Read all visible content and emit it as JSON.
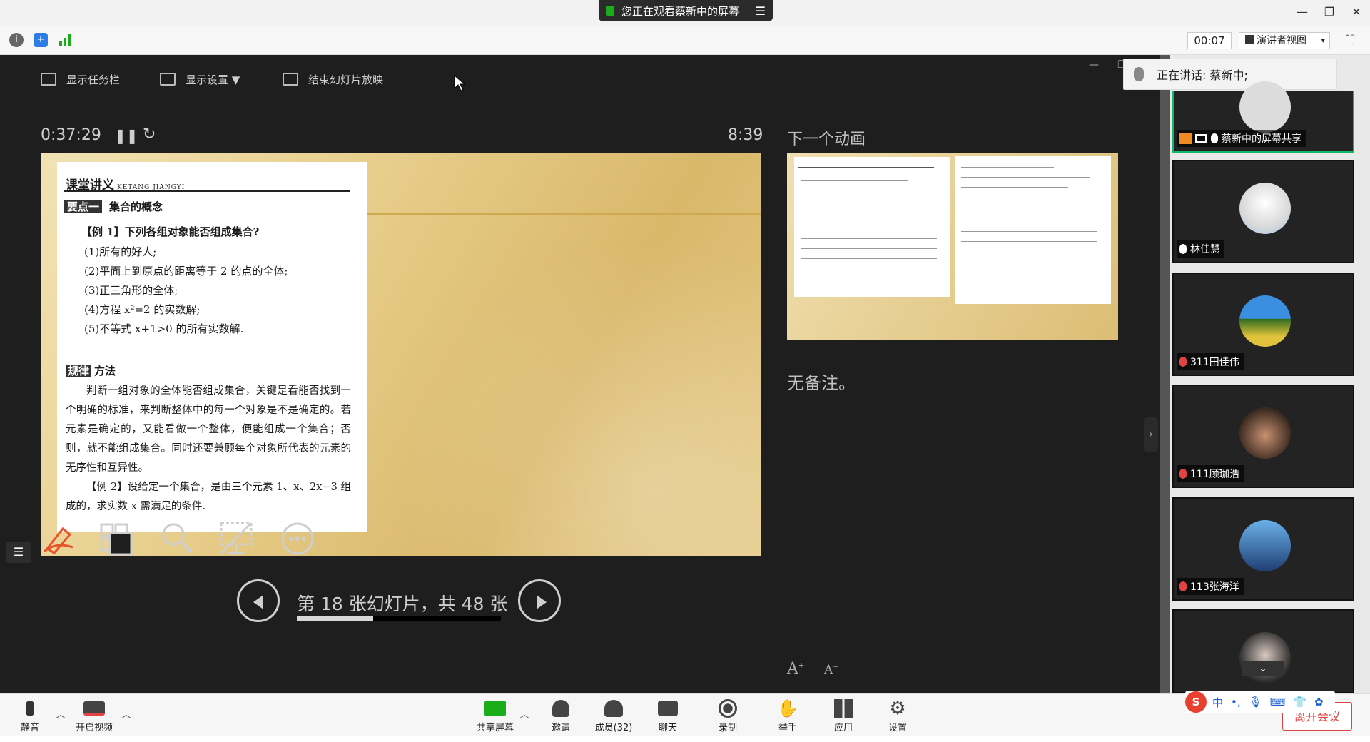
{
  "titlebar": {
    "sharing_text": "您正在观看蔡新中的屏幕",
    "menu_icon": "hamburger-icon",
    "window_controls": [
      "minimize-icon",
      "restore-icon",
      "close-icon"
    ]
  },
  "infobar": {
    "icons": [
      "info-icon",
      "shield-icon",
      "signal-icon"
    ],
    "timer": "00:07",
    "view_mode": "演讲者视图",
    "view_caret": "▾"
  },
  "presenter": {
    "toolbar": {
      "show_taskbar": "显示任务栏",
      "display_settings": "显示设置 ▼",
      "end_slideshow": "结束幻灯片放映"
    },
    "elapsed": "0:37:29",
    "clock": "8:39",
    "next_label": "下一个动画",
    "notes": "无备注。",
    "slide_counter": "第 18 张幻灯片，共 48 张",
    "progress": 0.375,
    "font_up": "A",
    "font_down": "A",
    "slide": {
      "header": "课堂讲义",
      "header_sub": "KETANG JIANGYI",
      "tag_box": "要点一",
      "tag_text": "集合的概念",
      "example1_title": "【例 1】下列各组对象能否组成集合?",
      "items": [
        "(1)所有的好人;",
        "(2)平面上到原点的距离等于 2 的点的全体;",
        "(3)正三角形的全体;",
        "(4)方程 x²=2 的实数解;",
        "(5)不等式 x+1>0 的所有实数解."
      ],
      "method_box": "规律",
      "method_text": "方法",
      "method_para": "判断一组对象的全体能否组成集合，关键是看能否找到一个明确的标准，来判断整体中的每一个对象是不是确定的。若元素是确定的，又能看做一个整体，便能组成一个集合；否则，就不能组成集合。同时还要兼顾每个对象所代表的元素的无序性和互异性。",
      "example2": "【例 2】设给定一个集合，是由三个元素 1、x、2x−3 组成的，求实数 x 需满足的条件."
    }
  },
  "speaking": "正在讲话: 蔡新中;",
  "participants": [
    {
      "name": "蔡新中的屏幕共享",
      "muted": false,
      "active": true
    },
    {
      "name": "林佳慧",
      "muted": false,
      "active": false
    },
    {
      "name": "311田佳伟",
      "muted": true,
      "active": false
    },
    {
      "name": "111顾珈浩",
      "muted": true,
      "active": false
    },
    {
      "name": "113张海洋",
      "muted": true,
      "active": false
    },
    {
      "name": "",
      "muted": false,
      "active": false
    }
  ],
  "bottom_toolbar": {
    "mute": "静音",
    "start_video": "开启视频",
    "share_screen": "共享屏幕",
    "invite": "邀请",
    "members": "成员(32)",
    "chat": "聊天",
    "record": "录制",
    "raise_hand": "举手",
    "apps": "应用",
    "settings": "设置",
    "leave": "离开会议"
  },
  "ime": {
    "logo": "S",
    "lang": "中",
    "punct": "•,"
  },
  "colors": {
    "accent_green": "#12b76a",
    "muted_red": "#e04343",
    "presenter_bg": "#1e1e1e"
  }
}
